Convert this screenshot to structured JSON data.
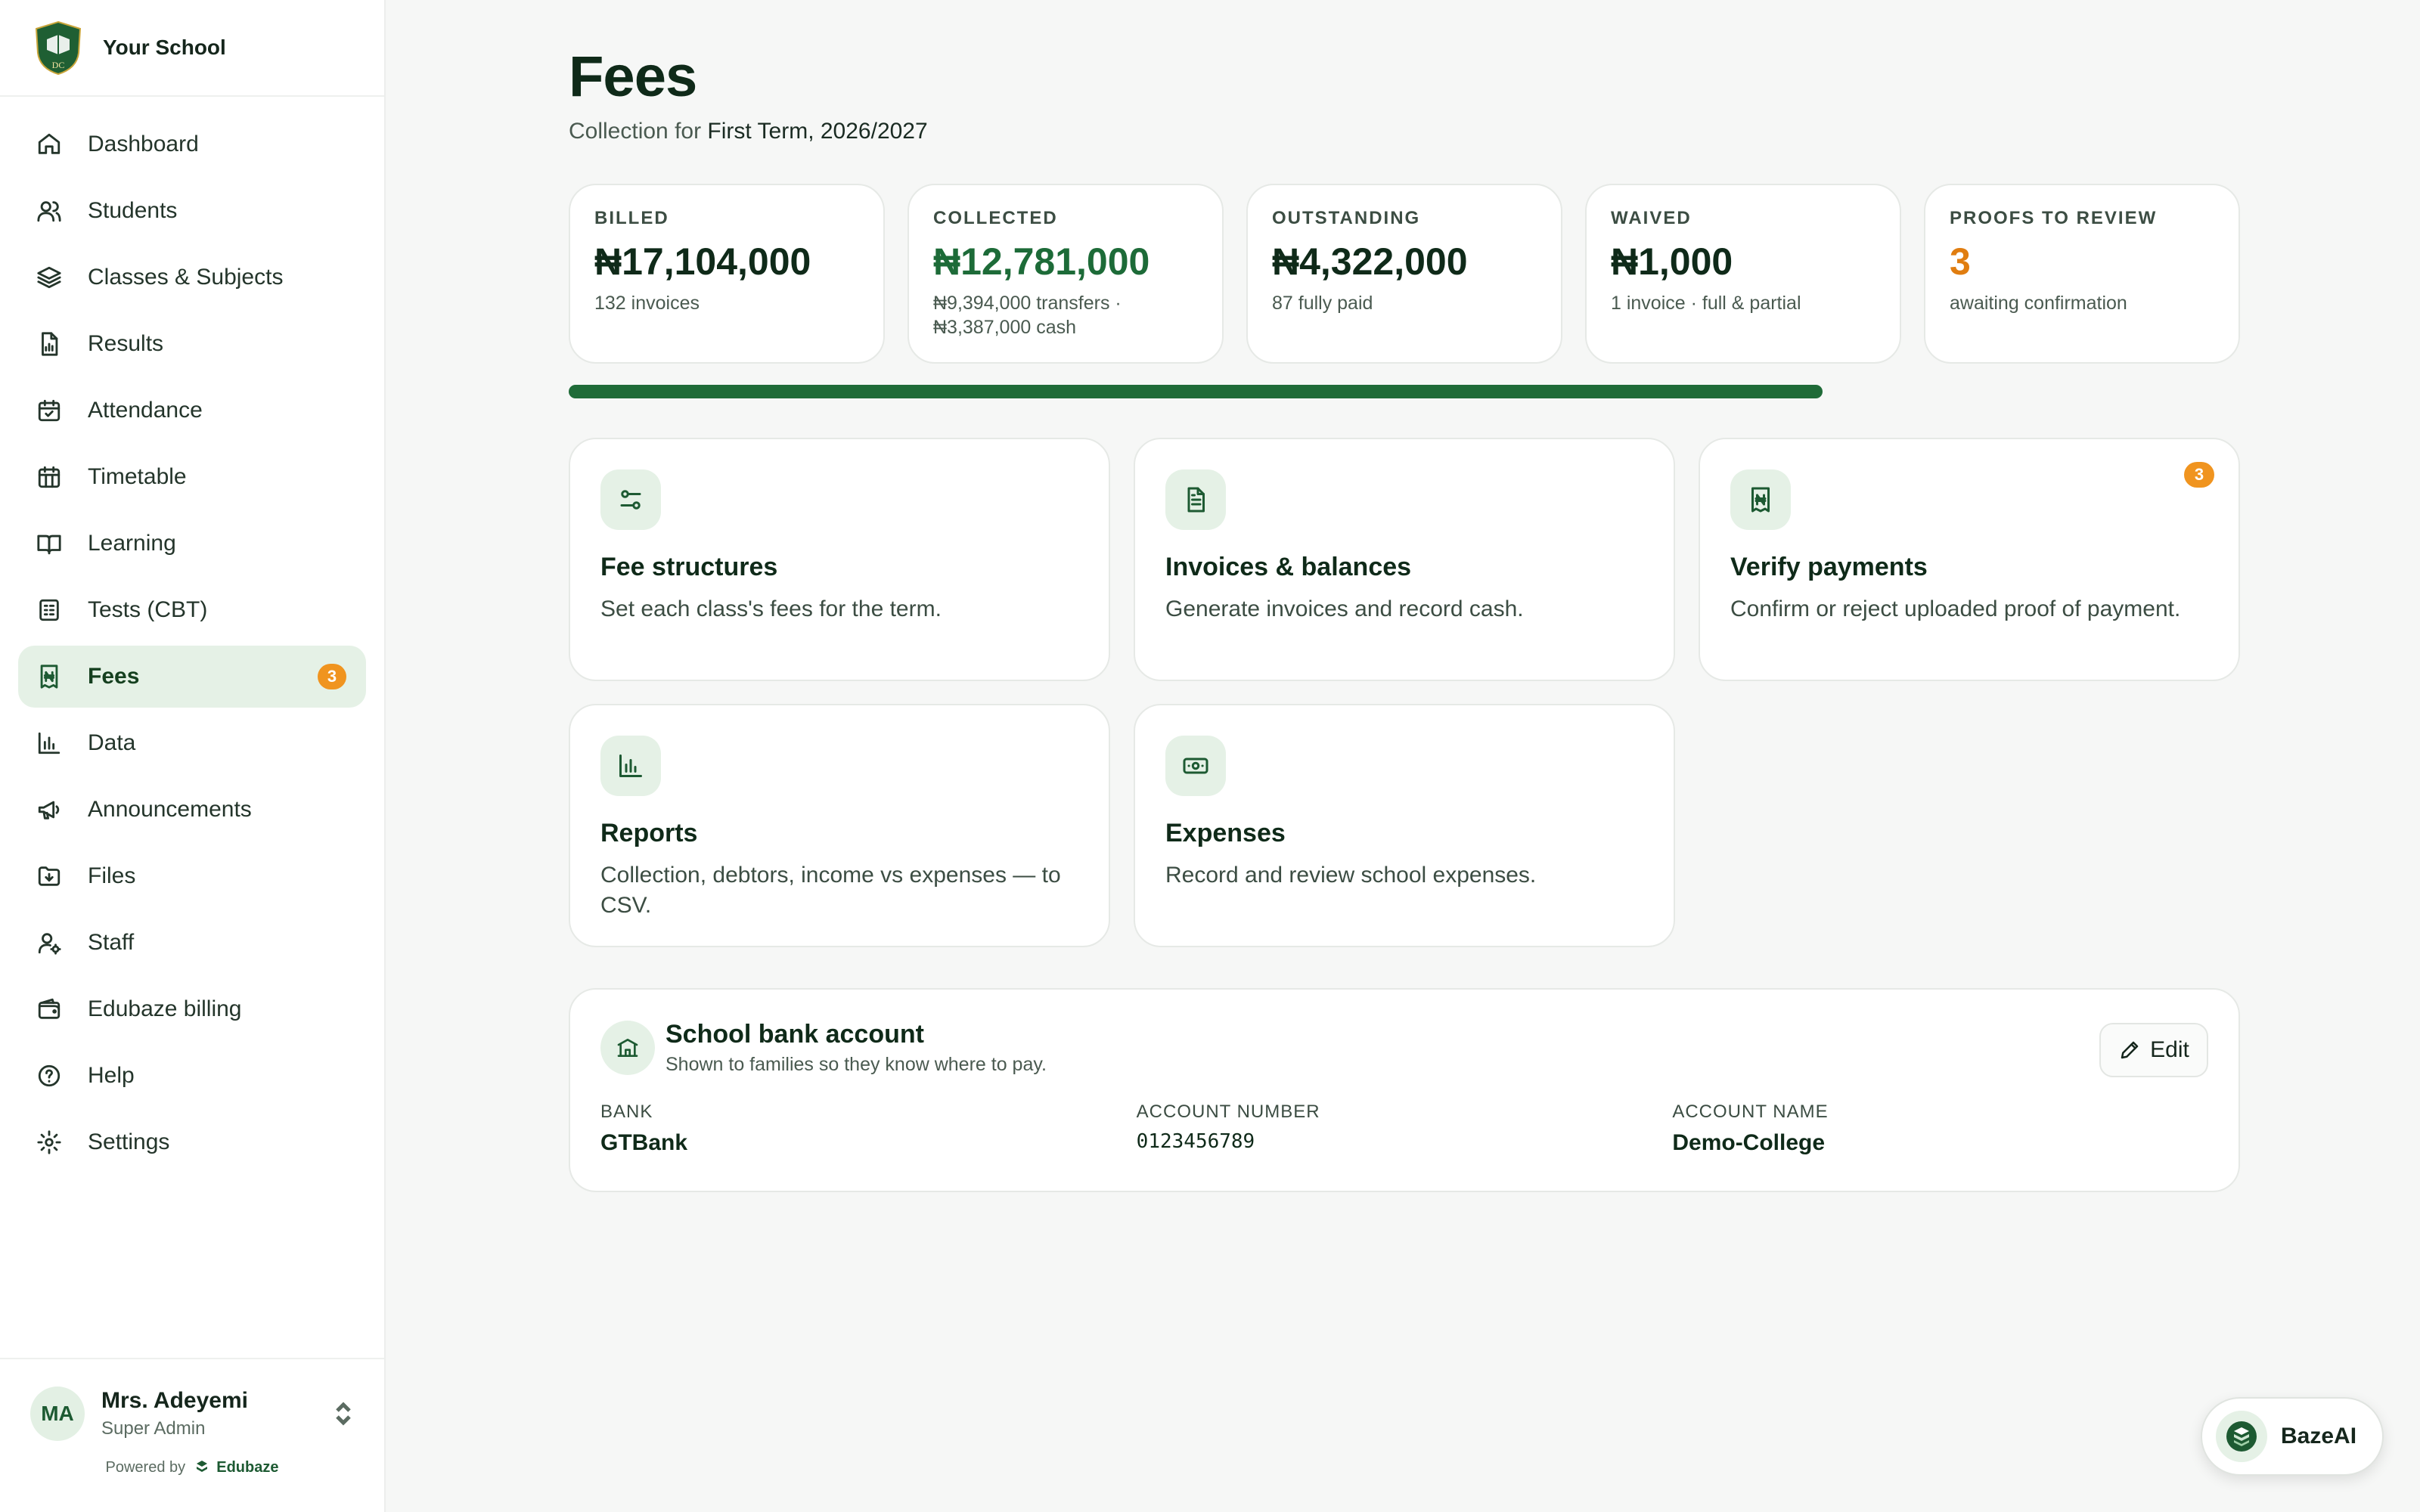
{
  "brand": {
    "name": "Your School",
    "crest_initials": "DC"
  },
  "nav": [
    {
      "label": "Dashboard",
      "icon": "home-icon"
    },
    {
      "label": "Students",
      "icon": "users-icon"
    },
    {
      "label": "Classes & Subjects",
      "icon": "layers-icon"
    },
    {
      "label": "Results",
      "icon": "file-chart-icon"
    },
    {
      "label": "Attendance",
      "icon": "calendar-check-icon"
    },
    {
      "label": "Timetable",
      "icon": "calendar-grid-icon"
    },
    {
      "label": "Learning",
      "icon": "book-open-icon"
    },
    {
      "label": "Tests (CBT)",
      "icon": "test-sheet-icon"
    },
    {
      "label": "Fees",
      "icon": "naira-receipt-icon",
      "badge": "3",
      "active": true
    },
    {
      "label": "Data",
      "icon": "bar-chart-icon"
    },
    {
      "label": "Announcements",
      "icon": "megaphone-icon"
    },
    {
      "label": "Files",
      "icon": "folder-icon"
    },
    {
      "label": "Staff",
      "icon": "user-cog-icon"
    },
    {
      "label": "Edubaze billing",
      "icon": "wallet-icon"
    },
    {
      "label": "Help",
      "icon": "help-circle-icon"
    },
    {
      "label": "Settings",
      "icon": "settings-icon"
    }
  ],
  "user": {
    "initials": "MA",
    "name": "Mrs. Adeyemi",
    "role": "Super Admin"
  },
  "powered": {
    "prefix": "Powered by",
    "brand": "Edubaze"
  },
  "page": {
    "title": "Fees",
    "subtitle_prefix": "Collection for",
    "term": "First Term, 2026/2027"
  },
  "stats": [
    {
      "label": "BILLED",
      "value": "₦17,104,000",
      "sub": "132 invoices",
      "tone": "default"
    },
    {
      "label": "COLLECTED",
      "value": "₦12,781,000",
      "sub": "₦9,394,000 transfers · ₦3,387,000 cash",
      "tone": "green"
    },
    {
      "label": "OUTSTANDING",
      "value": "₦4,322,000",
      "sub": "87 fully paid",
      "tone": "default"
    },
    {
      "label": "WAIVED",
      "value": "₦1,000",
      "sub": "1 invoice · full & partial",
      "tone": "default"
    },
    {
      "label": "PROOFS TO REVIEW",
      "value": "3",
      "sub": "awaiting confirmation",
      "tone": "orange"
    }
  ],
  "collection_progress": 0.75,
  "tiles": [
    {
      "title": "Fee structures",
      "desc": "Set each class's fees for the term.",
      "icon": "sliders-icon"
    },
    {
      "title": "Invoices & balances",
      "desc": "Generate invoices and record cash.",
      "icon": "document-icon"
    },
    {
      "title": "Verify payments",
      "desc": "Confirm or reject uploaded proof of payment.",
      "icon": "naira-receipt-icon",
      "badge": "3"
    },
    {
      "title": "Reports",
      "desc": "Collection, debtors, income vs expenses — to CSV.",
      "icon": "bar-chart-icon"
    },
    {
      "title": "Expenses",
      "desc": "Record and review school expenses.",
      "icon": "banknote-icon"
    }
  ],
  "bank": {
    "title": "School bank account",
    "subtitle": "Shown to families so they know where to pay.",
    "edit_label": "Edit",
    "fields": [
      {
        "label": "BANK",
        "value": "GTBank"
      },
      {
        "label": "ACCOUNT NUMBER",
        "value": "0123456789"
      },
      {
        "label": "ACCOUNT NAME",
        "value": "Demo-College"
      }
    ]
  },
  "assistant": {
    "label": "BazeAI"
  },
  "colors": {
    "accent": "#1d5a32",
    "badge": "#f0941f",
    "active_bg": "#e5f1e6"
  }
}
